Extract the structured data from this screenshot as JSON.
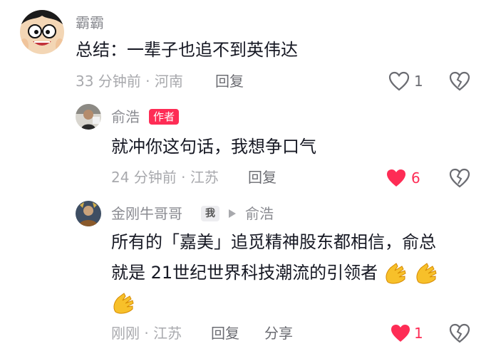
{
  "comments": [
    {
      "username": "霸霸",
      "text": "总结：一辈子也追不到英伟达",
      "time_location": "33 分钟前 · 河南",
      "reply_label": "回复",
      "likes": "1",
      "liked": false
    },
    {
      "username": "俞浩",
      "badge": "作者",
      "text": "就冲你这句话，我想争口气",
      "time_location": "24 分钟前 · 江苏",
      "reply_label": "回复",
      "likes": "6",
      "liked": true
    },
    {
      "username": "金刚牛哥哥",
      "badge": "我",
      "reply_to": "俞浩",
      "text_line1": "所有的「嘉美」追觅精神股东都相信，俞总",
      "text_line2": "就是 21世纪世界科技潮流的引领者",
      "time_location": "刚刚 · 江苏",
      "reply_label": "回复",
      "share_label": "分享",
      "likes": "1",
      "liked": true
    }
  ],
  "colors": {
    "accent": "#fe2c55",
    "text": "#161823",
    "muted": "#a8a9ad"
  },
  "icons": [
    "heart-icon",
    "broken-heart-icon",
    "clapping-hands-emoji",
    "triangle-arrow-icon"
  ]
}
